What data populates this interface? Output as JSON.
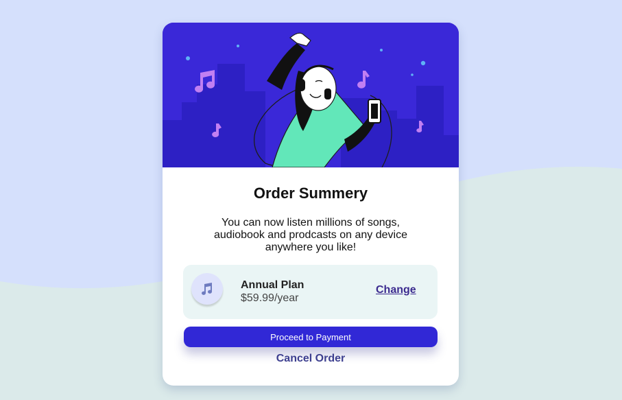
{
  "colors": {
    "page_background": "#d5e0fc",
    "wave": "#dbeaea",
    "hero_background": "#3a28d8",
    "primary_button": "#3128d6",
    "link": "#3c2b8f"
  },
  "hero": {
    "illustration": "person-dancing-with-headphones-illustration"
  },
  "card": {
    "title": "Order Summery",
    "description": "You can now listen millions of songs, audiobook and prodcasts on any device anywhere you like!"
  },
  "plan": {
    "icon": "music-note-icon",
    "name": "Annual Plan",
    "price": "$59.99/year",
    "change_label": "Change"
  },
  "actions": {
    "proceed_label": "Proceed to Payment",
    "cancel_label": "Cancel Order"
  }
}
